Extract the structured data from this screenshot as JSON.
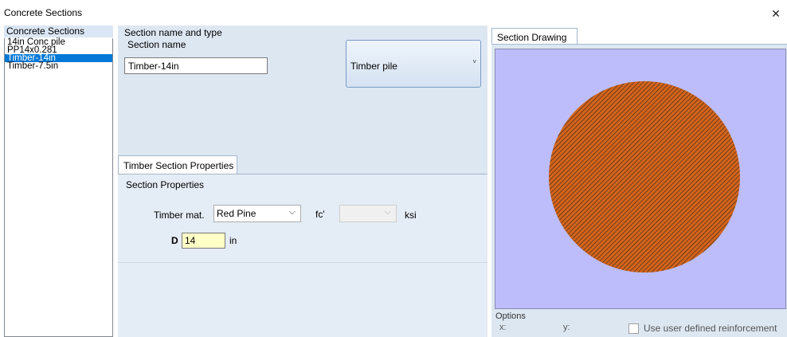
{
  "window": {
    "title": "Concrete Sections",
    "close_glyph": "✕"
  },
  "section_list": {
    "header": "Concrete Sections",
    "items": [
      "14in Conc pile",
      "PP14x0.281",
      "Timber-14in",
      "Timber-7.5in"
    ],
    "selected_index": 2
  },
  "name_type": {
    "group_label": "Section name and type",
    "name_label": "Section name",
    "name_value": "Timber-14in",
    "type_value": "Timber pile"
  },
  "timber": {
    "tab_label": "Timber Section Properties",
    "group_label": "Section Properties",
    "mat_label": "Timber mat.",
    "mat_value": "Red Pine",
    "fc_label": "fc'",
    "fc_value": "",
    "fc_unit": "ksi",
    "d_label": "D",
    "d_value": "14",
    "d_unit": "in"
  },
  "drawing": {
    "tab_label": "Section Drawing",
    "options_label": "Options",
    "x_label": "x:",
    "y_label": "y:",
    "user_reinf_label": "Use user defined reinforcement",
    "user_reinf_checked": false,
    "canvas_color": "#bdbdfb",
    "section_fill": "#d4641c",
    "hatch_color": "#3a2a18"
  },
  "icons": {
    "close": "close-icon",
    "dropdown": "chevron-down-icon"
  }
}
